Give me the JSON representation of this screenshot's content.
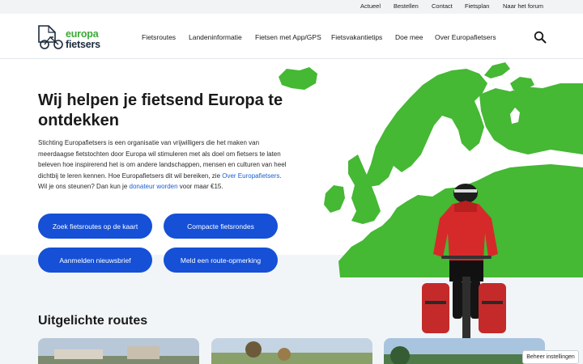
{
  "topbar": {
    "links": [
      "Actueel",
      "Bestellen",
      "Contact",
      "Fietsplan",
      "Naar het forum"
    ]
  },
  "logo": {
    "line1": "europa",
    "line2": "fietsers"
  },
  "nav": {
    "items": [
      "Fietsroutes",
      "Landeninformatie",
      "Fietsen met App/GPS",
      "Fietsvakantietips",
      "Doe mee",
      "Over Europafietsers"
    ]
  },
  "hero": {
    "title": "Wij helpen je fietsend Europa te ontdekken",
    "intro_part1": "Stichting Europafietsers is een organisatie van vrijwilligers die het maken van meerdaagse fietstochten door Europa wil stimuleren met als doel om fietsers te laten beleven hoe inspirerend het is om andere landschappen, mensen en culturen van heel dichtbij te leren kennen. Hoe Europafietsers dit wil bereiken, zie ",
    "intro_link1": "Over Europafietsers",
    "intro_part2": ". Wil je ons steunen? Dan kun je ",
    "intro_link2": "donateur worden",
    "intro_part3": " voor maar €15.",
    "buttons": [
      "Zoek fietsroutes op de kaart",
      "Compacte fietsrondes",
      "Aanmelden nieuwsbrief",
      "Meld een route-opmerking"
    ]
  },
  "featured": {
    "title": "Uitgelichte routes"
  },
  "cookie": {
    "label": "Beheer instellingen"
  },
  "colors": {
    "brand_green": "#3aaa35",
    "button_blue": "#1550d6",
    "map_green": "#45b834"
  }
}
